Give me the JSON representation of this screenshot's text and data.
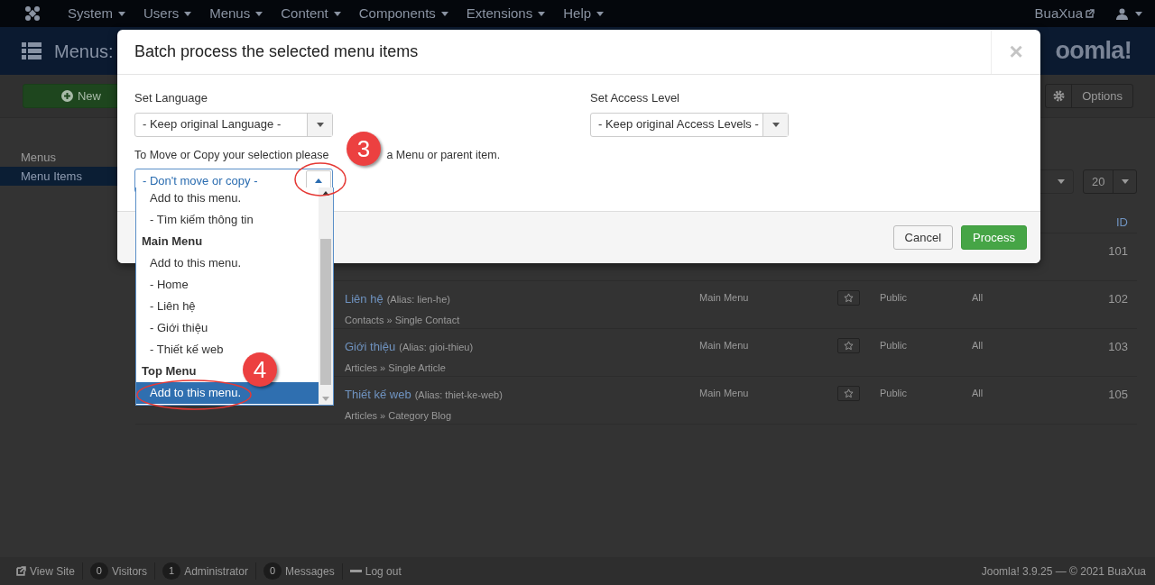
{
  "top_nav": {
    "items": [
      "System",
      "Users",
      "Menus",
      "Content",
      "Components",
      "Extensions",
      "Help"
    ],
    "site_link": "BuaXua"
  },
  "header": {
    "title": "Menus:",
    "logo": "oomla!"
  },
  "toolbar": {
    "new_button": "New",
    "options_button": "Options"
  },
  "sidebar": {
    "items": [
      {
        "label": "Menus",
        "selected": false
      },
      {
        "label": "Menu Items",
        "selected": true
      }
    ]
  },
  "list_limit": "20",
  "table": {
    "id_heading": "ID",
    "rows": [
      {
        "id": "101"
      },
      {
        "title": "Liên hệ",
        "alias": "(Alias: lien-he)",
        "type": "Contacts » Single Contact",
        "menu": "Main Menu",
        "access": "Public",
        "language": "All",
        "id": "102"
      },
      {
        "title": "Giới thiệu",
        "alias": "(Alias: gioi-thieu)",
        "type": "Articles » Single Article",
        "menu": "Main Menu",
        "access": "Public",
        "language": "All",
        "id": "103"
      },
      {
        "title": "Thiết kế web",
        "alias": "(Alias: thiet-ke-web)",
        "type": "Articles » Category Blog",
        "menu": "Main Menu",
        "access": "Public",
        "language": "All",
        "id": "105"
      }
    ]
  },
  "status_bar": {
    "items": [
      {
        "kind": "link",
        "label": "View Site"
      },
      {
        "kind": "count",
        "count": "0",
        "label": "Visitors"
      },
      {
        "kind": "count",
        "count": "1",
        "label": "Administrator"
      },
      {
        "kind": "count",
        "count": "0",
        "label": "Messages"
      },
      {
        "kind": "logout",
        "label": "Log out"
      }
    ],
    "copyright": "Joomla! 3.9.25 — © 2021 BuaXua"
  },
  "modal": {
    "title": "Batch process the selected menu items",
    "close": "×",
    "language": {
      "label": "Set Language",
      "value": "- Keep original Language -"
    },
    "access": {
      "label": "Set Access Level",
      "value": "- Keep original Access Levels -"
    },
    "move_hint": [
      "To Move or Copy your selection please",
      "a Menu or parent item."
    ],
    "move_select": {
      "value": "- Don't move or copy -",
      "expanded": true,
      "options": [
        {
          "kind": "option",
          "label": "Add to this menu.",
          "selected": false
        },
        {
          "kind": "option",
          "label": "- Tìm kiếm thông tin",
          "selected": false
        },
        {
          "kind": "group",
          "label": "Main Menu"
        },
        {
          "kind": "option",
          "label": "Add to this menu.",
          "selected": false
        },
        {
          "kind": "option",
          "label": "- Home",
          "selected": false
        },
        {
          "kind": "option",
          "label": "- Liên hệ",
          "selected": false
        },
        {
          "kind": "option",
          "label": "- Giới thiệu",
          "selected": false
        },
        {
          "kind": "option",
          "label": "- Thiết kế web",
          "selected": false
        },
        {
          "kind": "group",
          "label": "Top Menu"
        },
        {
          "kind": "option",
          "label": "Add to this menu.",
          "selected": true
        }
      ]
    },
    "buttons": [
      {
        "kind": "default",
        "label": "Cancel"
      },
      {
        "kind": "primary",
        "label": "Process"
      }
    ]
  },
  "annotations": [
    {
      "label": "3"
    },
    {
      "label": "4"
    }
  ]
}
